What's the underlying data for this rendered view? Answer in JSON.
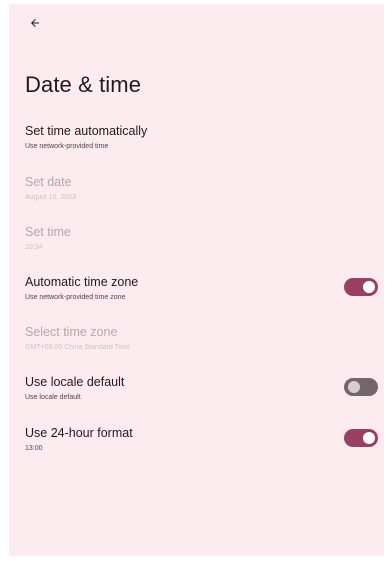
{
  "header": {
    "back_icon": "arrow-back-icon",
    "title": "Date & time"
  },
  "colors": {
    "background": "#fcecef",
    "switch_on": "#984061",
    "switch_off": "#74676b"
  },
  "settings": [
    {
      "title": "Set time automatically",
      "summary": "Use network-provided time",
      "enabled": true
    },
    {
      "title": "Set date",
      "summary": "August 10, 2023",
      "enabled": false
    },
    {
      "title": "Set time",
      "summary": "10:34",
      "enabled": false
    },
    {
      "title": "Automatic time zone",
      "summary": "Use network-provided time zone",
      "enabled": true,
      "switch": true
    },
    {
      "title": "Select time zone",
      "summary": "GMT+08:00 China Standard Time",
      "enabled": false
    },
    {
      "title": "Use locale default",
      "summary": "Use locale default",
      "enabled": true,
      "switch": false
    },
    {
      "title": "Use 24-hour format",
      "summary": "13:00",
      "enabled": true,
      "switch": true
    }
  ]
}
